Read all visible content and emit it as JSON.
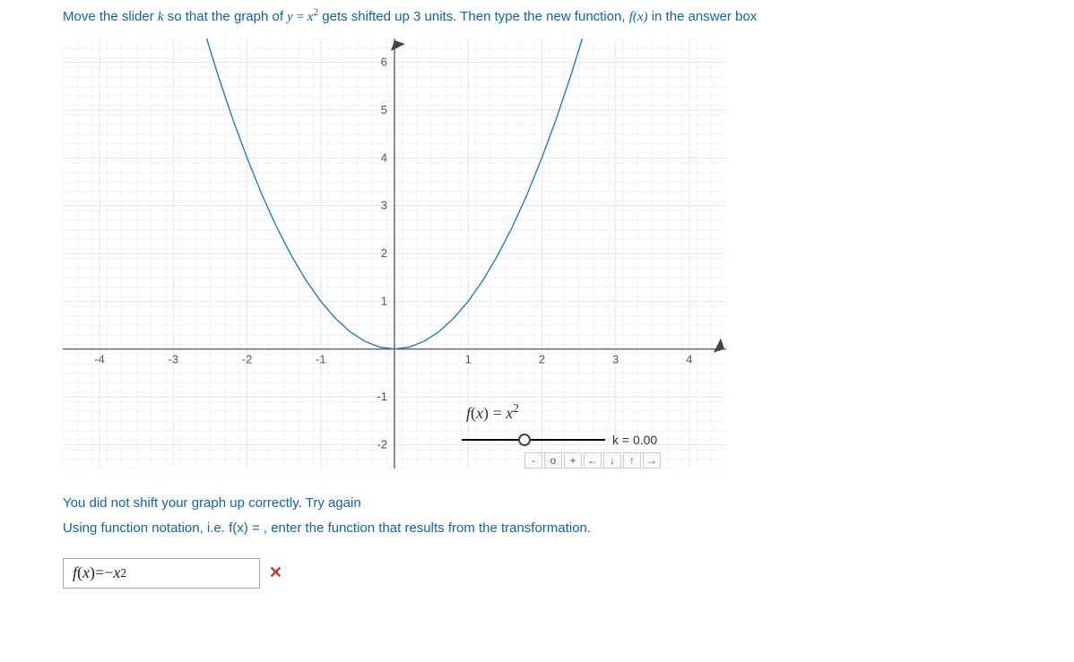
{
  "instruction": {
    "prefix": "Move the slider ",
    "var_k": "k",
    "mid1": " so that the graph of ",
    "lhs": "y",
    "eq": " = ",
    "rhs_base": "x",
    "rhs_exp": "2",
    "mid2": " gets shifted up 3 units. Then type the new function, ",
    "fx": "f(x)",
    "suffix": " in the answer box"
  },
  "chart_data": {
    "type": "line",
    "title": "",
    "xlabel": "",
    "ylabel": "",
    "xlim": [
      -4.5,
      4.5
    ],
    "ylim": [
      -2.5,
      6.5
    ],
    "x_ticks": [
      -4,
      -3,
      -2,
      -1,
      1,
      2,
      3,
      4
    ],
    "y_ticks": [
      -2,
      -1,
      1,
      2,
      3,
      4,
      5,
      6
    ],
    "series": [
      {
        "name": "f(x) = x^2",
        "x": [
          -2.6,
          -2.4,
          -2.2,
          -2,
          -1.8,
          -1.6,
          -1.4,
          -1.2,
          -1,
          -0.8,
          -0.6,
          -0.4,
          -0.2,
          0,
          0.2,
          0.4,
          0.6,
          0.8,
          1,
          1.2,
          1.4,
          1.6,
          1.8,
          2,
          2.2,
          2.4,
          2.6
        ],
        "y": [
          6.76,
          5.76,
          4.84,
          4,
          3.24,
          2.56,
          1.96,
          1.44,
          1,
          0.64,
          0.36,
          0.16,
          0.04,
          0,
          0.04,
          0.16,
          0.36,
          0.64,
          1,
          1.44,
          1.96,
          2.56,
          3.24,
          4,
          4.84,
          5.76,
          6.76
        ]
      }
    ],
    "curve_label": "f(x) = x²",
    "slider": {
      "name": "k",
      "value": 0.0,
      "min": -5,
      "max": 5,
      "display": "k = 0.00"
    }
  },
  "controls": {
    "minus": "-",
    "reset": "o",
    "plus": "+",
    "left": "←",
    "down": "↓",
    "up": "↑",
    "right": "→"
  },
  "feedback": {
    "line1": "You did not shift your graph up correctly. Try again",
    "line2": "Using function notation, i.e. f(x) = , enter the function that results from the transformation."
  },
  "answer": {
    "value": "f(x) = −x²",
    "fx_lhs": "f(x)",
    "eq": " = ",
    "neg": "−",
    "base": "x",
    "exp": "2",
    "mark": "✕"
  }
}
